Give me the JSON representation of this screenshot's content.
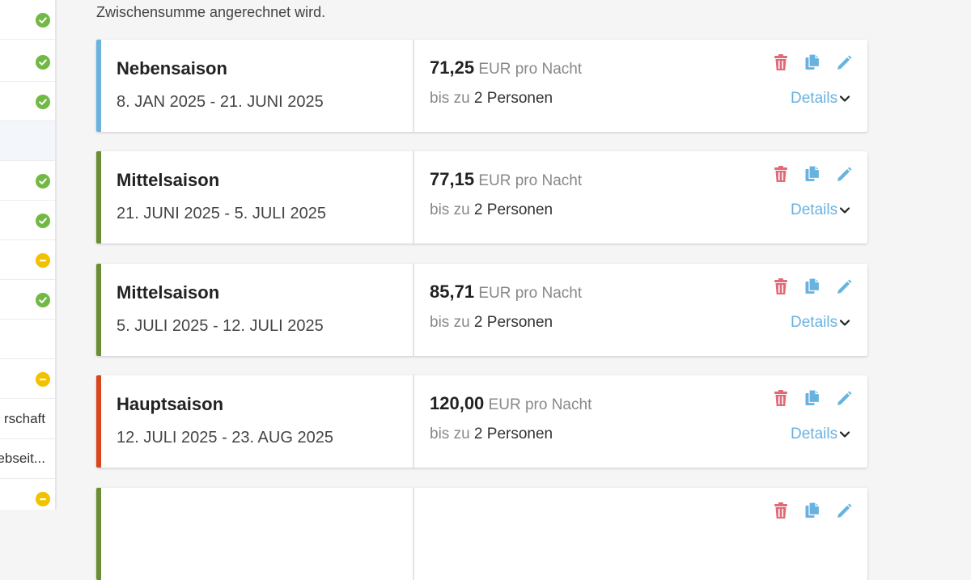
{
  "intro_text": "Zwischensumme angerechnet wird.",
  "sidebar": {
    "items": [
      {
        "status": "ok",
        "label": ""
      },
      {
        "status": "ok",
        "label": ""
      },
      {
        "status": "ok",
        "label": ""
      },
      {
        "status": "none",
        "label": ""
      },
      {
        "status": "ok",
        "label": ""
      },
      {
        "status": "ok",
        "label": ""
      },
      {
        "status": "warn",
        "label": ""
      },
      {
        "status": "ok",
        "label": ""
      },
      {
        "status": "none",
        "label": ""
      },
      {
        "status": "warn",
        "label": ""
      },
      {
        "status": "none",
        "label": "rschaft"
      },
      {
        "status": "none",
        "label": "Webseit..."
      },
      {
        "status": "warn",
        "label": ""
      }
    ]
  },
  "seasons": [
    {
      "name": "Nebensaison",
      "dates": "8. JAN 2025 - 21. JUNI 2025",
      "price": "71,25",
      "unit": "EUR pro Nacht",
      "persons_prefix": "bis zu",
      "persons": "2 Personen",
      "details": "Details",
      "color": "#6bb3df"
    },
    {
      "name": "Mittelsaison",
      "dates": "21. JUNI 2025 - 5. JULI 2025",
      "price": "77,15",
      "unit": "EUR pro Nacht",
      "persons_prefix": "bis zu",
      "persons": "2 Personen",
      "details": "Details",
      "color": "#6a8e34"
    },
    {
      "name": "Mittelsaison",
      "dates": "5. JULI 2025 - 12. JULI 2025",
      "price": "85,71",
      "unit": "EUR pro Nacht",
      "persons_prefix": "bis zu",
      "persons": "2 Personen",
      "details": "Details",
      "color": "#6a8e34"
    },
    {
      "name": "Hauptsaison",
      "dates": "12. JULI 2025 - 23. AUG 2025",
      "price": "120,00",
      "unit": "EUR pro Nacht",
      "persons_prefix": "bis zu",
      "persons": "2 Personen",
      "details": "Details",
      "color": "#d9451f"
    },
    {
      "name": "",
      "dates": "",
      "price": "",
      "unit": "",
      "persons_prefix": "",
      "persons": "",
      "details": "",
      "color": "#6a8e34"
    }
  ],
  "icons": {
    "delete": "trash-icon",
    "copy": "copy-icon",
    "edit": "pencil-icon",
    "expand": "chevron-down-icon"
  },
  "colors": {
    "delete": "#e06a78",
    "copy_edit": "#69b2e0",
    "ok": "#71b944",
    "warn": "#f2c200"
  }
}
